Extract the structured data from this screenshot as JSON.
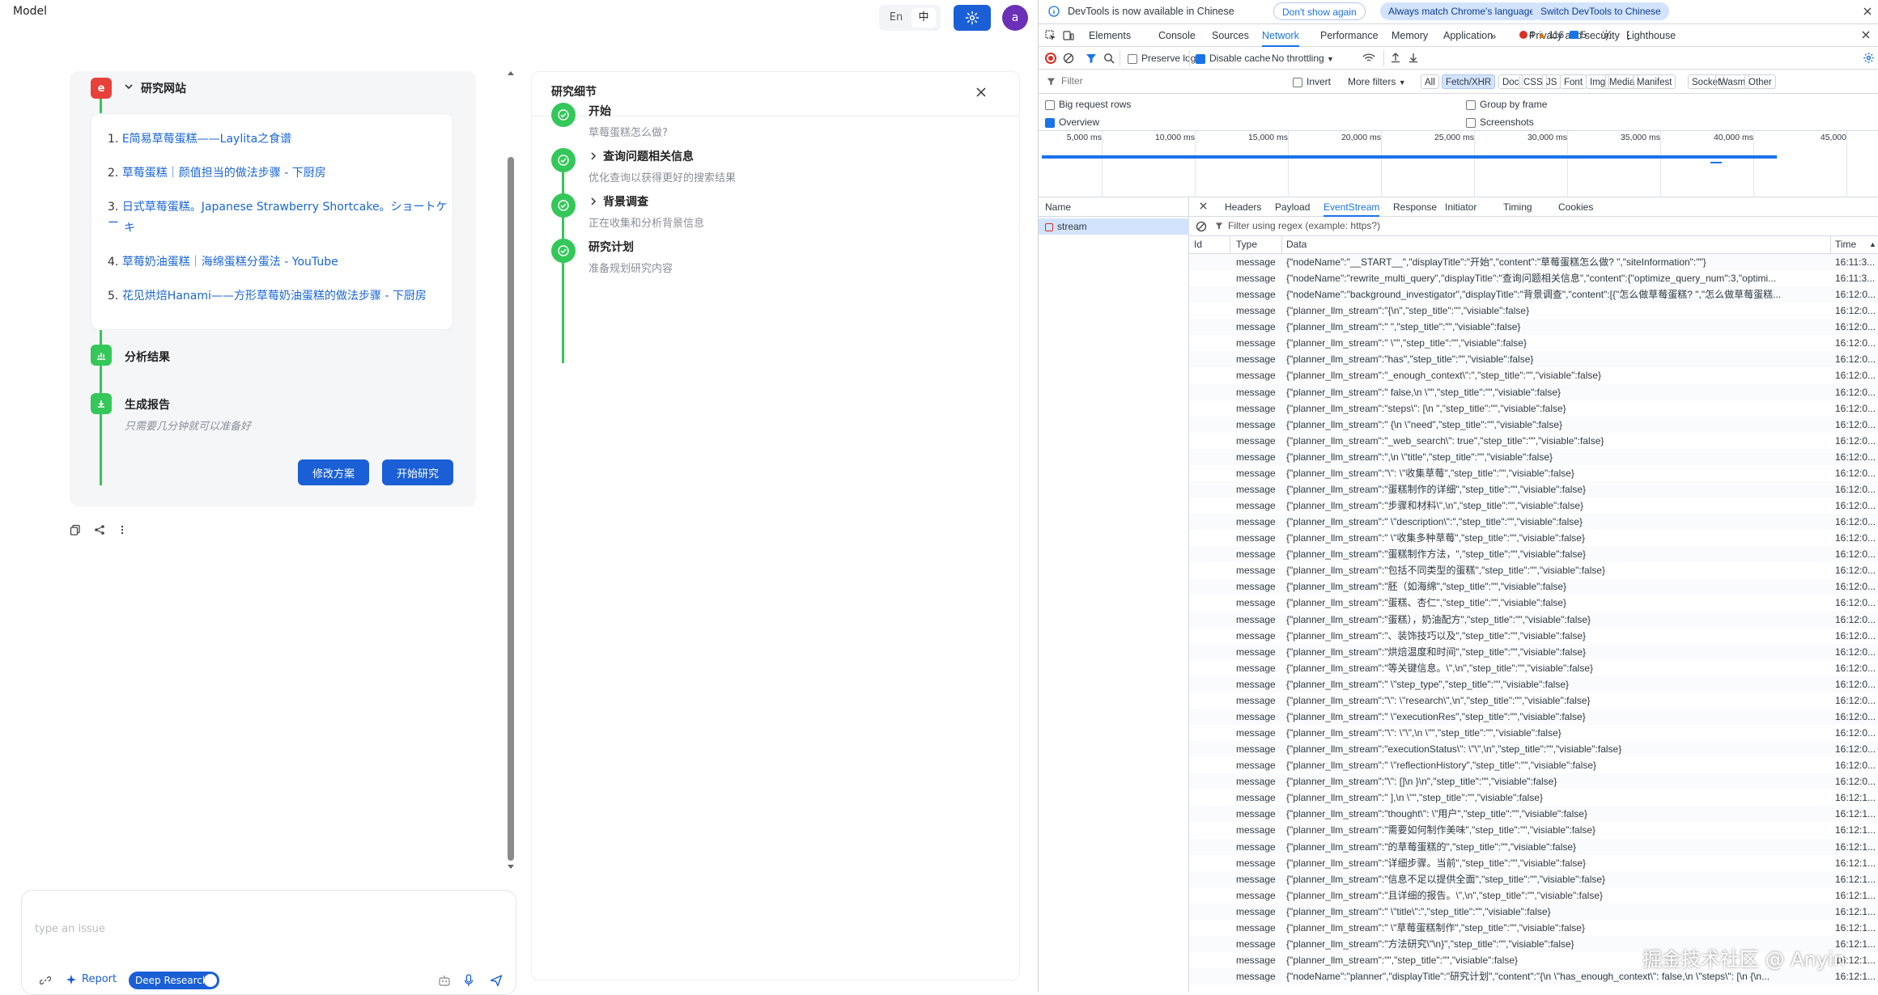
{
  "app": {
    "model_label": "Model",
    "lang": {
      "en": "En",
      "zh": "中"
    },
    "avatar_letter": "a",
    "sites": {
      "title": "研究网站",
      "items": [
        {
          "num": "1.",
          "text": "E简易草莓蛋糕——Laylita之食谱"
        },
        {
          "num": "2.",
          "text": "草莓蛋糕｜颜值担当的做法步骤 - 下厨房"
        },
        {
          "num": "3.",
          "text": "日式草莓蛋糕。Japanese Strawberry Shortcake。ショートケー",
          "text2": "キ"
        },
        {
          "num": "4.",
          "text": "草莓奶油蛋糕｜海绵蛋糕分蛋法 - YouTube"
        },
        {
          "num": "5.",
          "text": "花见烘焙Hanami——方形草莓奶油蛋糕的做法步骤 - 下厨房"
        }
      ]
    },
    "analyze": {
      "title": "分析结果"
    },
    "report": {
      "title": "生成报告",
      "subtitle": "只需要几分钟就可以准备好"
    },
    "buttons": {
      "modify": "修改方案",
      "start": "开始研究"
    },
    "detail": {
      "title": "研究细节",
      "steps": [
        {
          "title": "开始",
          "desc": "草莓蛋糕怎么做?",
          "chevron": false
        },
        {
          "title": "查询问题相关信息",
          "desc": "优化查询以获得更好的搜索结果",
          "chevron": true
        },
        {
          "title": "背景调查",
          "desc": "正在收集和分析背景信息",
          "chevron": true
        },
        {
          "title": "研究计划",
          "desc": "准备规划研究内容",
          "chevron": false
        }
      ]
    },
    "input": {
      "placeholder": "type an issue",
      "report_label": "Report",
      "deep_research_label": "Deep Research"
    }
  },
  "devtools": {
    "notice": {
      "text": "DevTools is now available in Chinese",
      "dont_show": "Don't show again",
      "always_match": "Always match Chrome's language",
      "switch": "Switch DevTools to Chinese"
    },
    "tabs": [
      "Elements",
      "Console",
      "Sources",
      "Network",
      "Performance",
      "Memory",
      "Application",
      "Privacy and security",
      "Lighthouse"
    ],
    "active_tab": "Network",
    "badges": {
      "errors": "4",
      "warnings": "116",
      "info": "5"
    },
    "toolbar": {
      "preserve_log": "Preserve log",
      "disable_cache": "Disable cache",
      "throttling": "No throttling"
    },
    "filter": {
      "placeholder": "Filter",
      "invert": "Invert",
      "more_filters": "More filters",
      "types": [
        "All",
        "Fetch/XHR",
        "Doc",
        "CSS",
        "JS",
        "Font",
        "Img",
        "Media",
        "Manifest",
        "Socket",
        "Wasm",
        "Other"
      ],
      "active_type": "Fetch/XHR"
    },
    "options": {
      "big_rows": "Big request rows",
      "group_by_frame": "Group by frame",
      "overview": "Overview",
      "screenshots": "Screenshots"
    },
    "timeline_ticks": [
      "5,000 ms",
      "10,000 ms",
      "15,000 ms",
      "20,000 ms",
      "25,000 ms",
      "30,000 ms",
      "35,000 ms",
      "40,000 ms",
      "45,000"
    ],
    "name_header": "Name",
    "request_name": "stream",
    "detail_tabs": [
      "Headers",
      "Payload",
      "EventStream",
      "Response",
      "Initiator",
      "Timing",
      "Cookies"
    ],
    "active_detail_tab": "EventStream",
    "regex_placeholder": "Filter using regex (example: https?)",
    "columns": {
      "id": "Id",
      "type": "Type",
      "data": "Data",
      "time": "Time"
    },
    "messages": [
      {
        "type": "message",
        "data": "{\"nodeName\":\"__START__\",\"displayTitle\":\"开始\",\"content\":\"草莓蛋糕怎么做?  \",\"siteInformation\":\"\"}",
        "time": "16:11:3..."
      },
      {
        "type": "message",
        "data": "{\"nodeName\":\"rewrite_multi_query\",\"displayTitle\":\"查询问题相关信息\",\"content\":{\"optimize_query_num\":3,\"optimi...",
        "time": "16:11:3..."
      },
      {
        "type": "message",
        "data": "{\"nodeName\":\"background_investigator\",\"displayTitle\":\"背景调查\",\"content\":[{\"怎么做草莓蛋糕? \",\"怎么做草莓蛋糕...",
        "time": "16:12:0..."
      },
      {
        "type": "message",
        "data": "{\"planner_llm_stream\":\"{\\n\",\"step_title\":\"\",\"visiable\":false}",
        "time": "16:12:0..."
      },
      {
        "type": "message",
        "data": "{\"planner_llm_stream\":\" \",\"step_title\":\"\",\"visiable\":false}",
        "time": "16:12:0..."
      },
      {
        "type": "message",
        "data": "{\"planner_llm_stream\":\" \\\"\",\"step_title\":\"\",\"visiable\":false}",
        "time": "16:12:0..."
      },
      {
        "type": "message",
        "data": "{\"planner_llm_stream\":\"has\",\"step_title\":\"\",\"visiable\":false}",
        "time": "16:12:0..."
      },
      {
        "type": "message",
        "data": "{\"planner_llm_stream\":\"_enough_context\\\":\",\"step_title\":\"\",\"visiable\":false}",
        "time": "16:12:0..."
      },
      {
        "type": "message",
        "data": "{\"planner_llm_stream\":\" false,\\n \\\"\",\"step_title\":\"\",\"visiable\":false}",
        "time": "16:12:0..."
      },
      {
        "type": "message",
        "data": "{\"planner_llm_stream\":\"steps\\\": [\\n \",\"step_title\":\"\",\"visiable\":false}",
        "time": "16:12:0..."
      },
      {
        "type": "message",
        "data": "{\"planner_llm_stream\":\" {\\n \\\"need\",\"step_title\":\"\",\"visiable\":false}",
        "time": "16:12:0..."
      },
      {
        "type": "message",
        "data": "{\"planner_llm_stream\":\"_web_search\\\": true\",\"step_title\":\"\",\"visiable\":false}",
        "time": "16:12:0..."
      },
      {
        "type": "message",
        "data": "{\"planner_llm_stream\":\",\\n \\\"title\",\"step_title\":\"\",\"visiable\":false}",
        "time": "16:12:0..."
      },
      {
        "type": "message",
        "data": "{\"planner_llm_stream\":\"\\\": \\\"收集草莓\",\"step_title\":\"\",\"visiable\":false}",
        "time": "16:12:0..."
      },
      {
        "type": "message",
        "data": "{\"planner_llm_stream\":\"蛋糕制作的详细\",\"step_title\":\"\",\"visiable\":false}",
        "time": "16:12:0..."
      },
      {
        "type": "message",
        "data": "{\"planner_llm_stream\":\"步骤和材料\\\",\\n\",\"step_title\":\"\",\"visiable\":false}",
        "time": "16:12:0..."
      },
      {
        "type": "message",
        "data": "{\"planner_llm_stream\":\" \\\"description\\\":\",\"step_title\":\"\",\"visiable\":false}",
        "time": "16:12:0..."
      },
      {
        "type": "message",
        "data": "{\"planner_llm_stream\":\" \\\"收集多种草莓\",\"step_title\":\"\",\"visiable\":false}",
        "time": "16:12:0..."
      },
      {
        "type": "message",
        "data": "{\"planner_llm_stream\":\"蛋糕制作方法，\",\"step_title\":\"\",\"visiable\":false}",
        "time": "16:12:0..."
      },
      {
        "type": "message",
        "data": "{\"planner_llm_stream\":\"包括不同类型的蛋糕\",\"step_title\":\"\",\"visiable\":false}",
        "time": "16:12:0..."
      },
      {
        "type": "message",
        "data": "{\"planner_llm_stream\":\"胚（如海绵\",\"step_title\":\"\",\"visiable\":false}",
        "time": "16:12:0..."
      },
      {
        "type": "message",
        "data": "{\"planner_llm_stream\":\"蛋糕、杏仁\",\"step_title\":\"\",\"visiable\":false}",
        "time": "16:12:0..."
      },
      {
        "type": "message",
        "data": "{\"planner_llm_stream\":\"蛋糕），奶油配方\",\"step_title\":\"\",\"visiable\":false}",
        "time": "16:12:0..."
      },
      {
        "type": "message",
        "data": "{\"planner_llm_stream\":\"、装饰技巧以及\",\"step_title\":\"\",\"visiable\":false}",
        "time": "16:12:0..."
      },
      {
        "type": "message",
        "data": "{\"planner_llm_stream\":\"烘焙温度和时间\",\"step_title\":\"\",\"visiable\":false}",
        "time": "16:12:0..."
      },
      {
        "type": "message",
        "data": "{\"planner_llm_stream\":\"等关键信息。\\\",\\n\",\"step_title\":\"\",\"visiable\":false}",
        "time": "16:12:0..."
      },
      {
        "type": "message",
        "data": "{\"planner_llm_stream\":\" \\\"step_type\",\"step_title\":\"\",\"visiable\":false}",
        "time": "16:12:0..."
      },
      {
        "type": "message",
        "data": "{\"planner_llm_stream\":\"\\\": \\\"research\\\",\\n\",\"step_title\":\"\",\"visiable\":false}",
        "time": "16:12:0..."
      },
      {
        "type": "message",
        "data": "{\"planner_llm_stream\":\" \\\"executionRes\",\"step_title\":\"\",\"visiable\":false}",
        "time": "16:12:0..."
      },
      {
        "type": "message",
        "data": "{\"planner_llm_stream\":\"\\\": \\\"\\\",\\n \\\"\",\"step_title\":\"\",\"visiable\":false}",
        "time": "16:12:0..."
      },
      {
        "type": "message",
        "data": "{\"planner_llm_stream\":\"executionStatus\\\": \\\"\\\",\\n\",\"step_title\":\"\",\"visiable\":false}",
        "time": "16:12:0..."
      },
      {
        "type": "message",
        "data": "{\"planner_llm_stream\":\" \\\"reflectionHistory\",\"step_title\":\"\",\"visiable\":false}",
        "time": "16:12:0..."
      },
      {
        "type": "message",
        "data": "{\"planner_llm_stream\":\"\\\": []\\n }\\n\",\"step_title\":\"\",\"visiable\":false}",
        "time": "16:12:0..."
      },
      {
        "type": "message",
        "data": "{\"planner_llm_stream\":\" ],\\n \\\"\",\"step_title\":\"\",\"visiable\":false}",
        "time": "16:12:1..."
      },
      {
        "type": "message",
        "data": "{\"planner_llm_stream\":\"thought\\\": \\\"用户\",\"step_title\":\"\",\"visiable\":false}",
        "time": "16:12:1..."
      },
      {
        "type": "message",
        "data": "{\"planner_llm_stream\":\"需要如何制作美味\",\"step_title\":\"\",\"visiable\":false}",
        "time": "16:12:1..."
      },
      {
        "type": "message",
        "data": "{\"planner_llm_stream\":\"的草莓蛋糕的\",\"step_title\":\"\",\"visiable\":false}",
        "time": "16:12:1..."
      },
      {
        "type": "message",
        "data": "{\"planner_llm_stream\":\"详细步骤。当前\",\"step_title\":\"\",\"visiable\":false}",
        "time": "16:12:1..."
      },
      {
        "type": "message",
        "data": "{\"planner_llm_stream\":\"信息不足以提供全面\",\"step_title\":\"\",\"visiable\":false}",
        "time": "16:12:1..."
      },
      {
        "type": "message",
        "data": "{\"planner_llm_stream\":\"且详细的报告。\\\",\\n\",\"step_title\":\"\",\"visiable\":false}",
        "time": "16:12:1..."
      },
      {
        "type": "message",
        "data": "{\"planner_llm_stream\":\" \\\"title\\\":\",\"step_title\":\"\",\"visiable\":false}",
        "time": "16:12:1..."
      },
      {
        "type": "message",
        "data": "{\"planner_llm_stream\":\" \\\"草莓蛋糕制作\",\"step_title\":\"\",\"visiable\":false}",
        "time": "16:12:1..."
      },
      {
        "type": "message",
        "data": "{\"planner_llm_stream\":\"方法研究\\\"\\n}\",\"step_title\":\"\",\"visiable\":false}",
        "time": "16:12:1..."
      },
      {
        "type": "message",
        "data": "{\"planner_llm_stream\":\"\",\"step_title\":\"\",\"visiable\":false}",
        "time": "16:12:1..."
      },
      {
        "type": "message",
        "data": "{\"nodeName\":\"planner\",\"displayTitle\":\"研究计划\",\"content\":\"{\\n \\\"has_enough_context\\\": false,\\n \\\"steps\\\": [\\n {\\n...",
        "time": "16:12:1..."
      }
    ]
  },
  "watermark": "掘金技术社区 @ Anyin",
  "colors": {
    "accent": "#1a5fd6",
    "success": "#34c759",
    "devtools_blue": "#1a73e8",
    "avatar": "#6b2fb8"
  }
}
